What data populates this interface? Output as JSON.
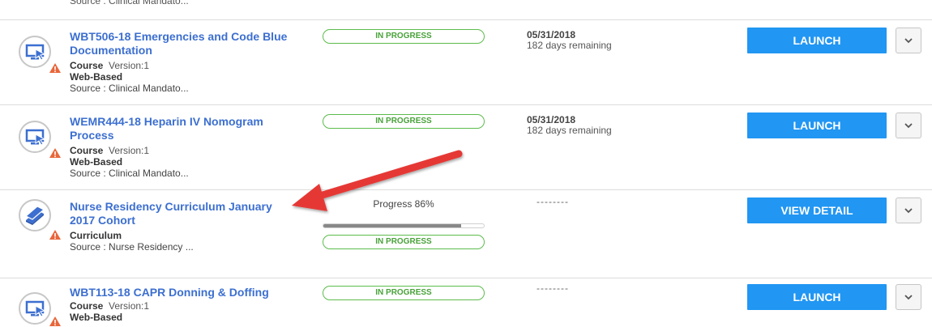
{
  "top_fragment": "Source : Clinical Mandato...",
  "rows": [
    {
      "title": "WBT506-18 Emergencies and Code Blue Documentation",
      "type": "Course",
      "version": "Version:1",
      "delivery": "Web-Based",
      "source": "Source : Clinical Mandato...",
      "status": "IN PROGRESS",
      "date": "05/31/2018",
      "remaining": "182 days remaining",
      "action": "LAUNCH",
      "icon": "computer-cursor-icon"
    },
    {
      "title": "WEMR444-18 Heparin IV Nomogram Process",
      "type": "Course",
      "version": "Version:1",
      "delivery": "Web-Based",
      "source": "Source : Clinical Mandato...",
      "status": "IN PROGRESS",
      "date": "05/31/2018",
      "remaining": "182 days remaining",
      "action": "LAUNCH",
      "icon": "computer-cursor-icon"
    },
    {
      "title": "Nurse Residency Curriculum January 2017 Cohort",
      "type": "Curriculum",
      "source": "Source : Nurse Residency ...",
      "progress_label": "Progress 86%",
      "progress": 86,
      "status": "IN PROGRESS",
      "date_placeholder": "--------",
      "action": "VIEW DETAIL",
      "icon": "books-icon"
    },
    {
      "title": "WBT113-18 CAPR Donning & Doffing",
      "type": "Course",
      "version": "Version:1",
      "delivery": "Web-Based",
      "status": "IN PROGRESS",
      "date_placeholder": "--------",
      "action": "LAUNCH",
      "icon": "computer-cursor-icon"
    }
  ],
  "colors": {
    "accent": "#2196f3",
    "title_link": "#3c6fd0",
    "status_green": "#5cbc4c",
    "warning": "#e8663a",
    "annotation_arrow": "#e53935"
  }
}
